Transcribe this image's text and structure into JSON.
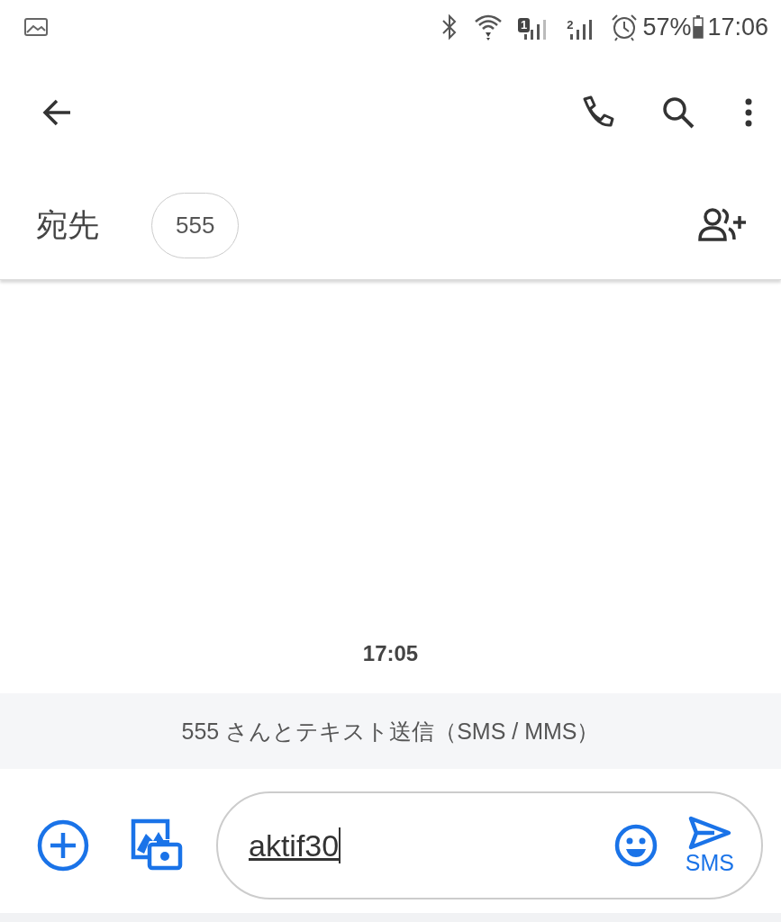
{
  "status_bar": {
    "sim_badges": [
      "1",
      "2"
    ],
    "battery": "57%",
    "time": "17:06"
  },
  "recipient": {
    "label": "宛先",
    "chips": [
      "555"
    ]
  },
  "conversation": {
    "timestamp": "17:05",
    "banner": "555 さんとテキスト送信（SMS / MMS）"
  },
  "compose": {
    "value": "aktif30",
    "send_label": "SMS"
  }
}
